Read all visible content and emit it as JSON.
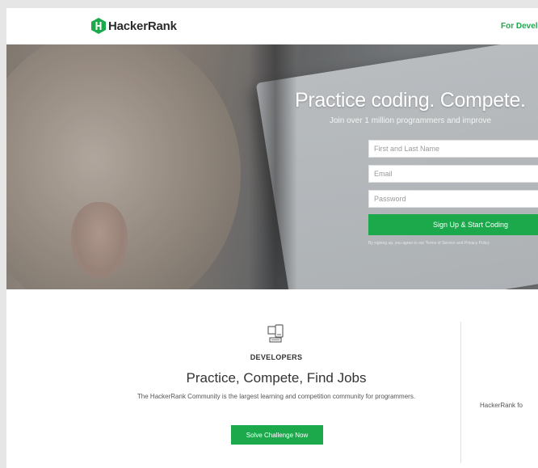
{
  "header": {
    "logo_text": "HackerRank",
    "nav_link": "For Develo"
  },
  "hero": {
    "title": "Practice coding. Compete.",
    "subtitle": "Join over 1 million programmers and improve",
    "name_placeholder": "First and Last Name",
    "email_placeholder": "Email",
    "password_placeholder": "Password",
    "signup_label": "Sign Up & Start Coding",
    "terms_text": "By signing up, you agree to our Terms of Service and Privacy Policy"
  },
  "developers": {
    "label": "DEVELOPERS",
    "title": "Practice, Compete, Find Jobs",
    "description": "The HackerRank Community is the largest learning and competition community for programmers.",
    "button_label": "Solve Challenge Now"
  },
  "companies": {
    "text": "HackerRank fo"
  },
  "colors": {
    "brand_green": "#1ba94c",
    "text_dark": "#333333"
  },
  "icons": {
    "logo": "hackerrank-logo-icon",
    "developers": "devices-icon"
  }
}
